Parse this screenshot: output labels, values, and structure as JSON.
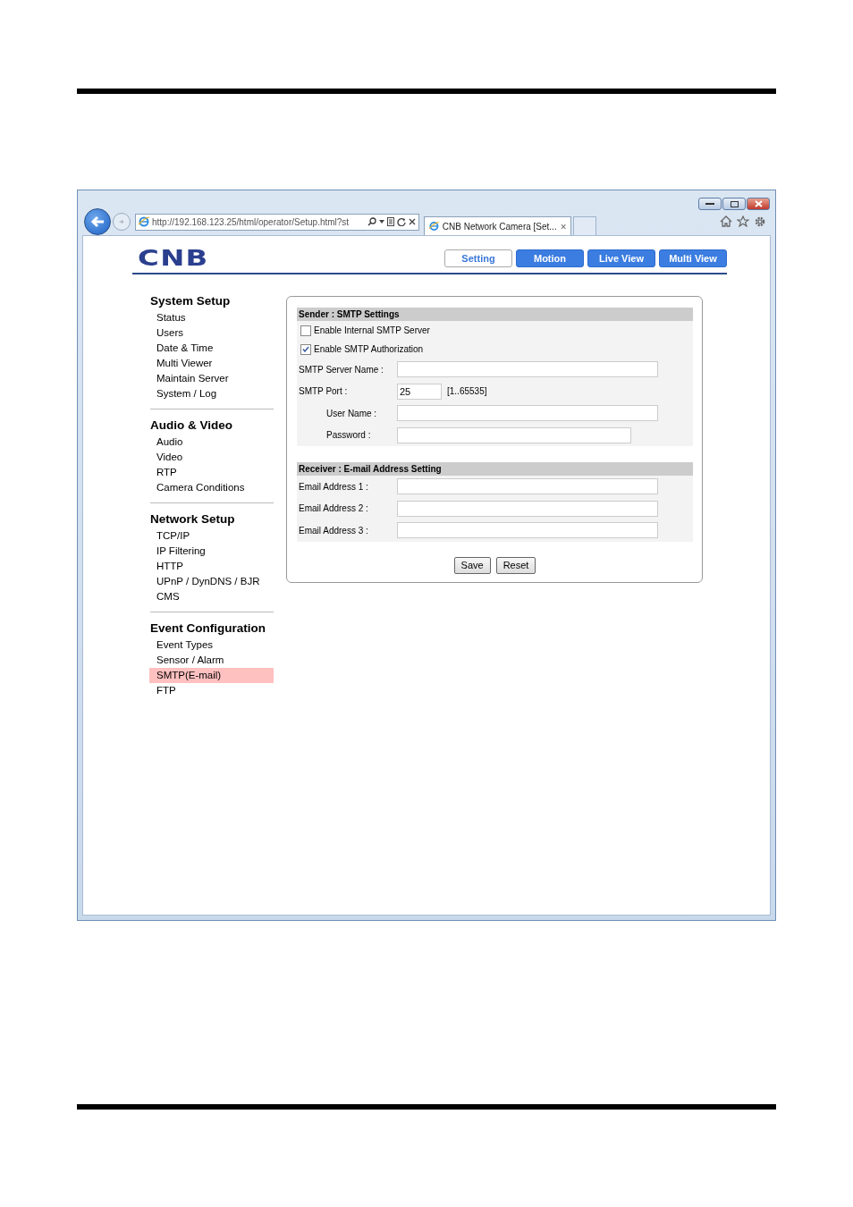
{
  "browser": {
    "address": "http://192.168.123.25/html/operator/Setup.html?st",
    "tab_title": "CNB Network Camera [Set..."
  },
  "logo": "CNB",
  "nav_buttons": [
    {
      "label": "Setting",
      "selected": true
    },
    {
      "label": "Motion",
      "selected": false
    },
    {
      "label": "Live View",
      "selected": false
    },
    {
      "label": "Multi View",
      "selected": false
    }
  ],
  "sidebar": {
    "sections": [
      {
        "title": "System Setup",
        "items": [
          {
            "label": "Status",
            "selected": false
          },
          {
            "label": "Users",
            "selected": false
          },
          {
            "label": "Date & Time",
            "selected": false
          },
          {
            "label": "Multi Viewer",
            "selected": false
          },
          {
            "label": "Maintain Server",
            "selected": false
          },
          {
            "label": "System / Log",
            "selected": false
          }
        ]
      },
      {
        "title": "Audio & Video",
        "items": [
          {
            "label": "Audio",
            "selected": false
          },
          {
            "label": "Video",
            "selected": false
          },
          {
            "label": "RTP",
            "selected": false
          },
          {
            "label": "Camera Conditions",
            "selected": false
          }
        ]
      },
      {
        "title": "Network Setup",
        "items": [
          {
            "label": "TCP/IP",
            "selected": false
          },
          {
            "label": "IP Filtering",
            "selected": false
          },
          {
            "label": "HTTP",
            "selected": false
          },
          {
            "label": "UPnP / DynDNS / BJR",
            "selected": false
          },
          {
            "label": "CMS",
            "selected": false
          }
        ]
      },
      {
        "title": "Event Configuration",
        "items": [
          {
            "label": "Event Types",
            "selected": false
          },
          {
            "label": "Sensor / Alarm",
            "selected": false
          },
          {
            "label": "SMTP(E-mail)",
            "selected": true
          },
          {
            "label": "FTP",
            "selected": false
          }
        ]
      }
    ]
  },
  "form": {
    "sections": [
      {
        "title": "Sender : SMTP Settings",
        "checkboxes": [
          {
            "label": "Enable Internal SMTP Server",
            "checked": false
          },
          {
            "label": "Enable SMTP Authorization",
            "checked": true
          }
        ],
        "fields": [
          {
            "label": "SMTP Server Name :",
            "kind": "text"
          },
          {
            "label": "SMTP Port :",
            "kind": "number",
            "value": "25",
            "hint": "[1..65535]"
          },
          {
            "label": "User Name :",
            "kind": "auth"
          },
          {
            "label": "Password :",
            "kind": "password"
          }
        ]
      },
      {
        "title": "Receiver : E-mail Address Setting",
        "fields": [
          {
            "label": "Email Address 1 :",
            "kind": "text"
          },
          {
            "label": "Email Address 2 :",
            "kind": "text"
          },
          {
            "label": "Email Address 3 :",
            "kind": "text"
          }
        ]
      }
    ],
    "buttons": [
      "Save",
      "Reset"
    ]
  }
}
